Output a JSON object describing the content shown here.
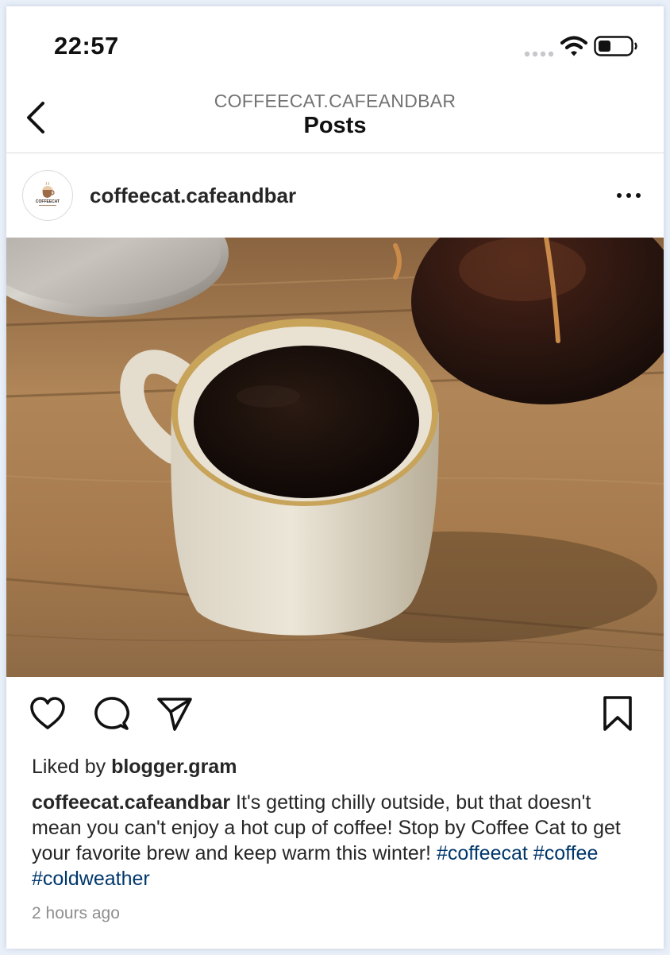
{
  "status_bar": {
    "time": "22:57"
  },
  "nav": {
    "subtitle": "COFFEECAT.CAFEANDBAR",
    "title": "Posts"
  },
  "post": {
    "username": "coffeecat.cafeandbar",
    "avatar_text": "COFFEECAT",
    "likes_prefix": "Liked by ",
    "liked_by": "blogger.gram",
    "caption_author": "coffeecat.cafeandbar",
    "caption_text": " It's getting chilly outside, but that doesn't mean you can't enjoy a hot cup of coffee! Stop by Coffee Cat to get your favorite brew and keep warm this winter! ",
    "hashtags": [
      "#coffeecat",
      "#coffee",
      "#coldweather"
    ],
    "timestamp": "2 hours ago"
  },
  "icons": {
    "back": "chevron-left-icon",
    "more": "more-horizontal-icon",
    "like": "heart-icon",
    "comment": "comment-icon",
    "share": "send-icon",
    "save": "bookmark-icon"
  },
  "colors": {
    "hashtag": "#00376b",
    "subtitle": "#737373",
    "timestamp": "#8e8e8e",
    "divider": "#dbdbdb"
  }
}
